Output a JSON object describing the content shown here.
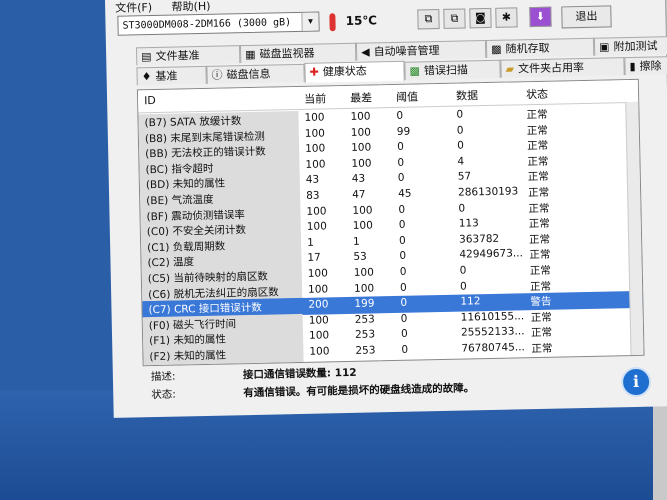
{
  "menu": [
    "文件(F)",
    "帮助(H)"
  ],
  "drive": {
    "selected": "ST3000DM008-2DM166 (3000 gB)"
  },
  "temperature": "15℃",
  "exit_label": "退出",
  "tabs_top": [
    {
      "label": "文件基准",
      "icon": "file-icon"
    },
    {
      "label": "磁盘监视器",
      "icon": "monitor-icon"
    },
    {
      "label": "自动噪音管理",
      "icon": "speaker-icon"
    },
    {
      "label": "随机存取",
      "icon": "random-icon"
    },
    {
      "label": "附加测试",
      "icon": "extra-icon"
    }
  ],
  "tabs_bottom": [
    {
      "label": "基准",
      "icon": "benchmark-icon"
    },
    {
      "label": "磁盘信息",
      "icon": "info-icon"
    },
    {
      "label": "健康状态",
      "icon": "health-icon",
      "active": true
    },
    {
      "label": "错误扫描",
      "icon": "scan-icon"
    },
    {
      "label": "文件夹占用率",
      "icon": "folder-icon"
    },
    {
      "label": "擦除",
      "icon": "erase-icon"
    }
  ],
  "columns": [
    "ID",
    "当前",
    "最差",
    "阈值",
    "数据",
    "状态"
  ],
  "rows": [
    {
      "id": "(B7) SATA 放缓计数",
      "cur": "100",
      "worst": "100",
      "thr": "0",
      "data": "0",
      "status": "正常"
    },
    {
      "id": "(B8) 末尾到末尾错误检测",
      "cur": "100",
      "worst": "100",
      "thr": "99",
      "data": "0",
      "status": "正常"
    },
    {
      "id": "(BB) 无法校正的错误计数",
      "cur": "100",
      "worst": "100",
      "thr": "0",
      "data": "0",
      "status": "正常"
    },
    {
      "id": "(BC) 指令超时",
      "cur": "100",
      "worst": "100",
      "thr": "0",
      "data": "4",
      "status": "正常"
    },
    {
      "id": "(BD) 未知的属性",
      "cur": "43",
      "worst": "43",
      "thr": "0",
      "data": "57",
      "status": "正常"
    },
    {
      "id": "(BE) 气流温度",
      "cur": "83",
      "worst": "47",
      "thr": "45",
      "data": "286130193",
      "status": "正常"
    },
    {
      "id": "(BF) 震动侦测错误率",
      "cur": "100",
      "worst": "100",
      "thr": "0",
      "data": "0",
      "status": "正常"
    },
    {
      "id": "(C0) 不安全关闭计数",
      "cur": "100",
      "worst": "100",
      "thr": "0",
      "data": "113",
      "status": "正常"
    },
    {
      "id": "(C1) 负载周期数",
      "cur": "1",
      "worst": "1",
      "thr": "0",
      "data": "363782",
      "status": "正常"
    },
    {
      "id": "(C2) 温度",
      "cur": "17",
      "worst": "53",
      "thr": "0",
      "data": "42949673...",
      "status": "正常"
    },
    {
      "id": "(C5) 当前待映射的扇区数",
      "cur": "100",
      "worst": "100",
      "thr": "0",
      "data": "0",
      "status": "正常"
    },
    {
      "id": "(C6) 脱机无法纠正的扇区数",
      "cur": "100",
      "worst": "100",
      "thr": "0",
      "data": "0",
      "status": "正常"
    },
    {
      "id": "(C7) CRC 接口错误计数",
      "cur": "200",
      "worst": "199",
      "thr": "0",
      "data": "112",
      "status": "警告",
      "selected": true
    },
    {
      "id": "(F0) 磁头飞行时间",
      "cur": "100",
      "worst": "253",
      "thr": "0",
      "data": "11610155...",
      "status": "正常"
    },
    {
      "id": "(F1) 未知的属性",
      "cur": "100",
      "worst": "253",
      "thr": "0",
      "data": "25552133...",
      "status": "正常"
    },
    {
      "id": "(F2) 未知的属性",
      "cur": "100",
      "worst": "253",
      "thr": "0",
      "data": "76780745...",
      "status": "正常"
    }
  ],
  "description": {
    "label": "描述:",
    "value": "接口通信错误数量: 112"
  },
  "state": {
    "label": "状态:",
    "value": "有通信错误。有可能是损坏的硬盘线造成的故障。"
  },
  "colors": {
    "selection": "#3a78d8",
    "warning": "#3a78d8"
  }
}
